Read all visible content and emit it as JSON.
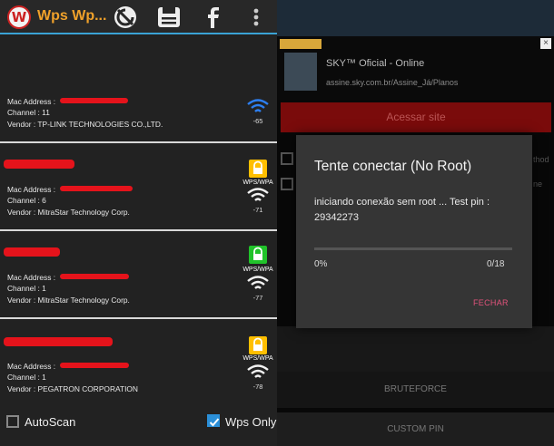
{
  "left_app": {
    "title": "Wps Wp...",
    "networks": [
      {
        "ssid": "",
        "mac": "Mac Address : ",
        "channel": "Channel : 11",
        "vendor": "Vendor : TP-LINK TECHNOLOGIES CO.,LTD.",
        "security": "",
        "signal": "-65"
      },
      {
        "ssid": "",
        "mac": "Mac Address : ",
        "channel": "Channel : 6",
        "vendor": "Vendor : MitraStar Technology Corp.",
        "security": "WPS/WPA",
        "signal": "-71"
      },
      {
        "ssid": "",
        "mac": "Mac Address : ",
        "channel": "Channel : 1",
        "vendor": "Vendor : MitraStar Technology Corp.",
        "security": "WPS/WPA",
        "signal": "-77"
      },
      {
        "ssid": "",
        "mac": "Mac Address : ",
        "channel": "Channel : 1",
        "vendor": "Vendor : PEGATRON CORPORATION",
        "security": "WPS/WPA",
        "signal": "-78"
      }
    ],
    "autoscan_label": "AutoScan",
    "autoscan_checked": false,
    "wps_only_label": "Wps Only",
    "wps_only_checked": true
  },
  "right_app": {
    "ad": {
      "title": "SKY™ Oficial - Online",
      "url": "assine.sky.com.br/Assine_Já/Planos",
      "cta": "Acessar site"
    },
    "dialog": {
      "title": "Tente conectar (No Root)",
      "message": "iniciando conexão sem root ... Test pin : 29342273",
      "progress_percent": 0,
      "progress_label": "0%",
      "progress_count": "0/18",
      "close_label": "FECHAR"
    },
    "bottom": {
      "bruteforce_label": "BRUTEFORCE",
      "custom_pin_label": "CUSTOM PIN"
    },
    "hidden_side_text": [
      "thod",
      "ne"
    ]
  }
}
